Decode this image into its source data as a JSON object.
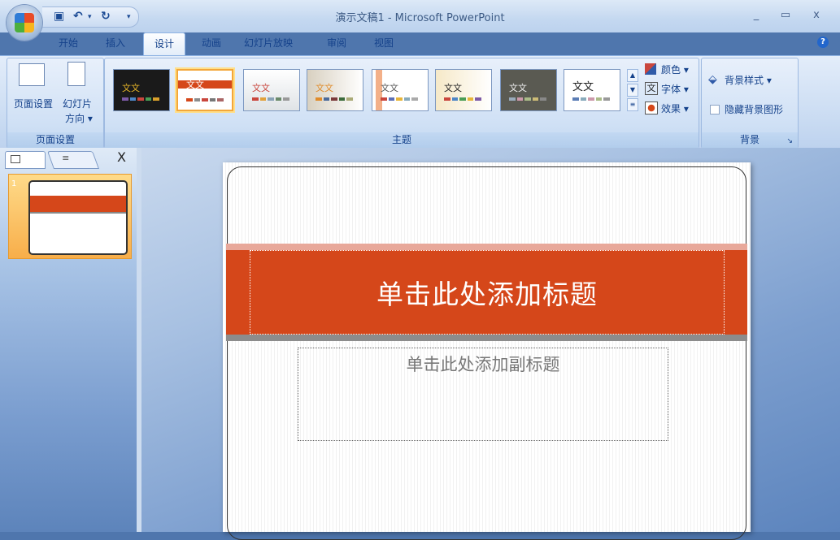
{
  "window": {
    "title": "演示文稿1 - Microsoft PowerPoint",
    "minimize": "_",
    "maximize": "▭",
    "close": "x"
  },
  "qat": {
    "save_icon": "save-icon",
    "undo_icon": "undo-icon",
    "redo_icon": "redo-icon"
  },
  "tabs": [
    "开始",
    "插入",
    "设计",
    "动画",
    "幻灯片放映",
    "审阅",
    "视图"
  ],
  "active_tab": "设计",
  "ribbon": {
    "page_setup": {
      "btn1": "页面设置",
      "btn2_line1": "幻灯片",
      "btn2_line2": "方向 ▾",
      "label": "页面设置"
    },
    "themes": {
      "thumb_text": "文文",
      "label": "主题",
      "colors": "颜色 ▾",
      "fonts": "字体 ▾",
      "effects": "效果 ▾"
    },
    "background": {
      "styles": "背景样式 ▾",
      "hide": "隐藏背景图形",
      "label": "背景"
    }
  },
  "colors": {
    "title_band": "#d5471a",
    "band_top": "#e8a89a",
    "band_bottom": "#8c8c8c",
    "selected_theme": "#f3a73a"
  },
  "slide_pane": {
    "slide_number": "1",
    "close": "X"
  },
  "slide": {
    "title_placeholder": "单击此处添加标题",
    "subtitle_placeholder": "单击此处添加副标题"
  }
}
